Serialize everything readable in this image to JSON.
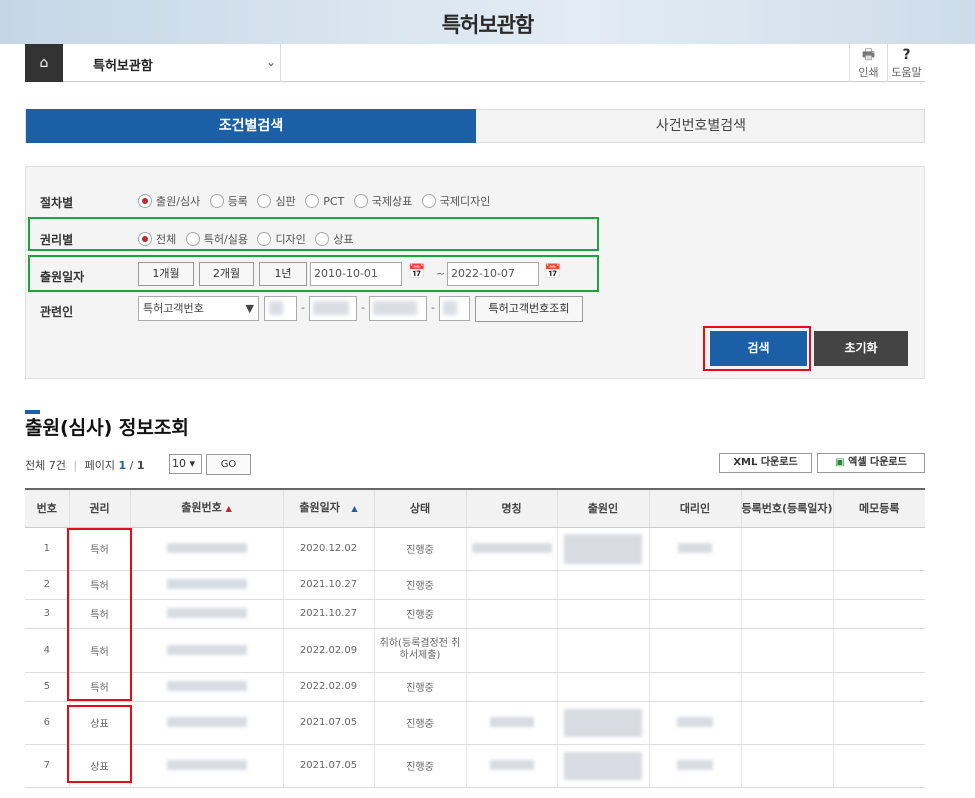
{
  "page_title": "특허보관함",
  "nav": {
    "home_icon": "home-icon",
    "selected": "특허보관함",
    "print_label": "인쇄",
    "help_label": "도움말",
    "help_icon": "?"
  },
  "tabs": {
    "condition": "조건별검색",
    "case_number": "사건번호별검색"
  },
  "search": {
    "procedure": {
      "label": "절차별",
      "options": [
        "출원/심사",
        "등록",
        "심판",
        "PCT",
        "국제상표",
        "국제디자인"
      ],
      "selected": 0
    },
    "right": {
      "label": "권리별",
      "options": [
        "전체",
        "특허/실용",
        "디자인",
        "상표"
      ],
      "selected": 0
    },
    "date": {
      "label": "출원일자",
      "periods": [
        "1개월",
        "2개월",
        "1년"
      ],
      "from": "2010-10-01",
      "to": "2022-10-07",
      "separator": "~"
    },
    "related": {
      "label": "관련인",
      "select": "특허고객번호",
      "lookup": "특허고객번호조회"
    },
    "search_button": "검색",
    "reset_button": "초기화"
  },
  "results": {
    "title": "출원(심사) 정보조회",
    "total_prefix": "전체 ",
    "total": "7건",
    "page_label": "페이지",
    "page_current": "1",
    "page_sep": "/",
    "page_total": "1",
    "page_size": "10",
    "go": "GO",
    "xml": "XML 다운로드",
    "excel": "엑셀 다운로드",
    "columns": [
      "번호",
      "권리",
      "출원번호",
      "출원일자",
      "상태",
      "명칭",
      "출원인",
      "대리인",
      "등록번호(등록일자)",
      "메모등록"
    ],
    "rows": [
      {
        "no": "1",
        "right": "특허",
        "date": "2020.12.02",
        "status": "진행중"
      },
      {
        "no": "2",
        "right": "특허",
        "date": "2021.10.27",
        "status": "진행중"
      },
      {
        "no": "3",
        "right": "특허",
        "date": "2021.10.27",
        "status": "진행중"
      },
      {
        "no": "4",
        "right": "특허",
        "date": "2022.02.09",
        "status": "취하(등록결정전 취하서제출)"
      },
      {
        "no": "5",
        "right": "특허",
        "date": "2022.02.09",
        "status": "진행중"
      },
      {
        "no": "6",
        "right": "상표",
        "date": "2021.07.05",
        "status": "진행중"
      },
      {
        "no": "7",
        "right": "상표",
        "date": "2021.07.05",
        "status": "진행중"
      }
    ]
  }
}
